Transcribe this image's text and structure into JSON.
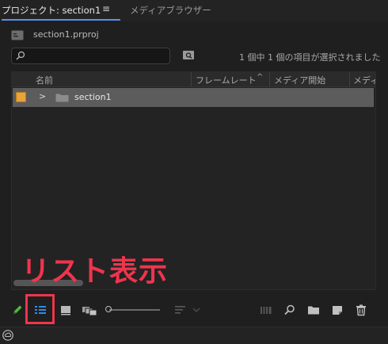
{
  "tabs": {
    "project": "プロジェクト: section1",
    "menu_glyph": "≡",
    "media_browser": "メディアブラウザー"
  },
  "project_file": "section1.prproj",
  "search": {
    "value": "",
    "placeholder": ""
  },
  "selection_status": "1 個中 1 個の項目が選択されました",
  "columns": [
    "名前",
    "フレームレート",
    "メディア開始",
    "メディ"
  ],
  "sort_indicator": "^",
  "items": [
    {
      "name": "section1",
      "label_color": "#e8a33b",
      "type": "bin",
      "selected": true
    }
  ],
  "annotation": "リスト表示",
  "accent_colors": {
    "annotation": "#f0344d",
    "selected_view": "#2d8ceb",
    "tab_underline": "#5b8ef0"
  },
  "toolbar_icons": [
    "pencil-icon",
    "list-view-icon",
    "icon-view-icon",
    "freeform-view-icon",
    "zoom-slider",
    "sort-icon",
    "automate-to-sequence-icon",
    "find-icon",
    "new-bin-icon",
    "new-item-icon",
    "clear-icon"
  ]
}
